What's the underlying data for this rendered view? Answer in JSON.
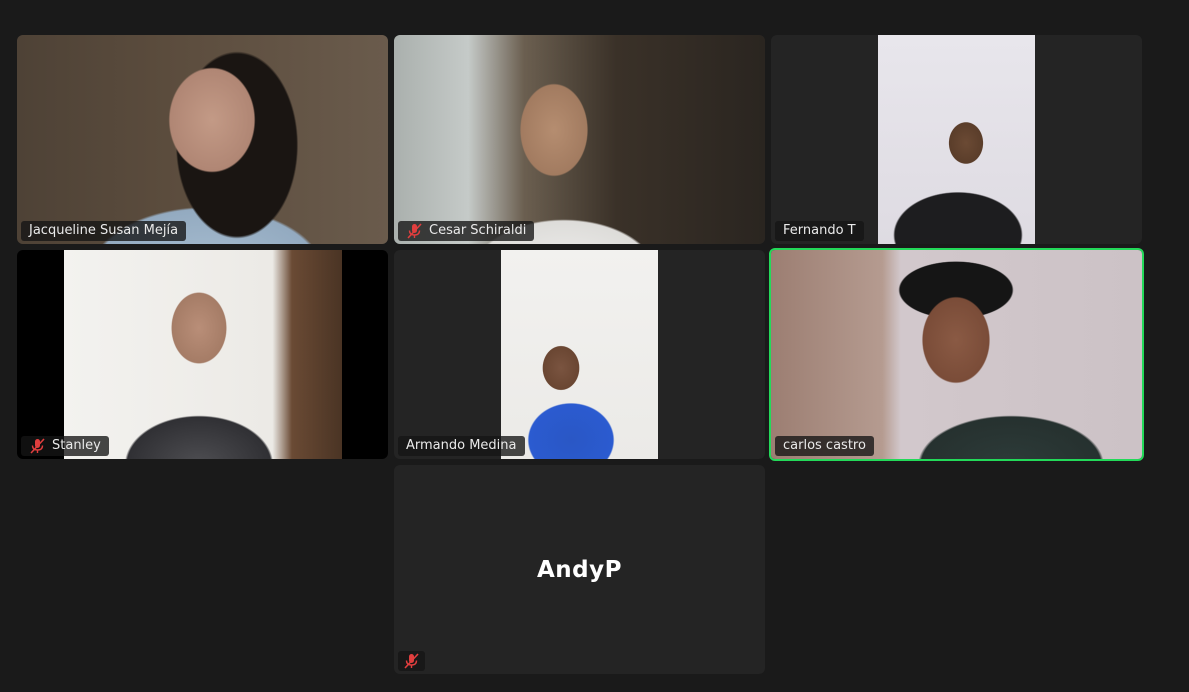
{
  "participants": [
    {
      "name": "Jacqueline Susan Mejía",
      "muted": false,
      "speaking": false,
      "video": true
    },
    {
      "name": "Cesar Schiraldi",
      "muted": true,
      "speaking": false,
      "video": true
    },
    {
      "name": "Fernando T",
      "muted": false,
      "speaking": false,
      "video": true
    },
    {
      "name": "Stanley",
      "muted": true,
      "speaking": false,
      "video": true
    },
    {
      "name": "Armando Medina",
      "muted": false,
      "speaking": false,
      "video": true
    },
    {
      "name": "carlos castro",
      "muted": false,
      "speaking": true,
      "video": true
    },
    {
      "name": "AndyP",
      "muted": true,
      "speaking": false,
      "video": false
    }
  ],
  "colors": {
    "background": "#1a1a1a",
    "tile": "#242424",
    "active_speaker_border": "#23d959",
    "muted_icon": "#e03e3e"
  },
  "icons": {
    "muted": "mic-muted-icon"
  }
}
